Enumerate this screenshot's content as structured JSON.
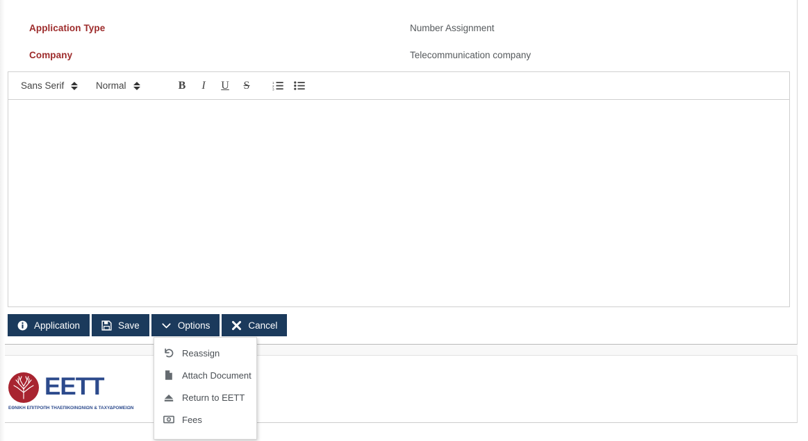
{
  "details": {
    "rows": [
      {
        "label": "Application Type",
        "value": "Number Assignment"
      },
      {
        "label": "Company",
        "value": "Telecommunication company"
      }
    ]
  },
  "editor": {
    "font_select": {
      "value": "Sans Serif",
      "icon": "double-chevron-icon"
    },
    "size_select": {
      "value": "Normal",
      "icon": "double-chevron-icon"
    },
    "buttons": [
      {
        "name": "bold",
        "label": "B"
      },
      {
        "name": "italic",
        "label": "I"
      },
      {
        "name": "underline",
        "label": "U"
      },
      {
        "name": "strike",
        "label": "S"
      }
    ],
    "list_buttons": [
      {
        "name": "ordered-list",
        "icon": "ordered-list-icon"
      },
      {
        "name": "bullet-list",
        "icon": "bullet-list-icon"
      }
    ],
    "content": ""
  },
  "actions": [
    {
      "name": "application",
      "label": "Application",
      "icon": "info-circle-icon"
    },
    {
      "name": "save",
      "label": "Save",
      "icon": "floppy-disk-icon"
    },
    {
      "name": "options",
      "label": "Options",
      "icon": "chevron-down-icon"
    },
    {
      "name": "cancel",
      "label": "Cancel",
      "icon": "close-x-icon"
    }
  ],
  "options_menu": {
    "open": true,
    "items": [
      {
        "name": "reassign",
        "label": "Reassign",
        "icon": "undo-arrow-icon"
      },
      {
        "name": "attach-document",
        "label": "Attach Document",
        "icon": "file-icon"
      },
      {
        "name": "return-to-eett",
        "label": "Return to EETT",
        "icon": "eject-icon"
      },
      {
        "name": "fees",
        "label": "Fees",
        "icon": "money-bill-icon"
      }
    ]
  },
  "footer": {
    "logo_text": "EETT",
    "logo_subtitle": "ΕΘΝΙΚΗ ΕΠΙΤΡΟΠΗ ΤΗΛΕΠΙΚΟΙΝΩΝΙΩΝ & ΤΑΧΥΔΡΟΜΕΙΩΝ"
  },
  "colors": {
    "label_red": "#9d2b2b",
    "button_navy": "#1b3a5c",
    "logo_blue": "#2c4a8c",
    "logo_red": "#a82430"
  }
}
